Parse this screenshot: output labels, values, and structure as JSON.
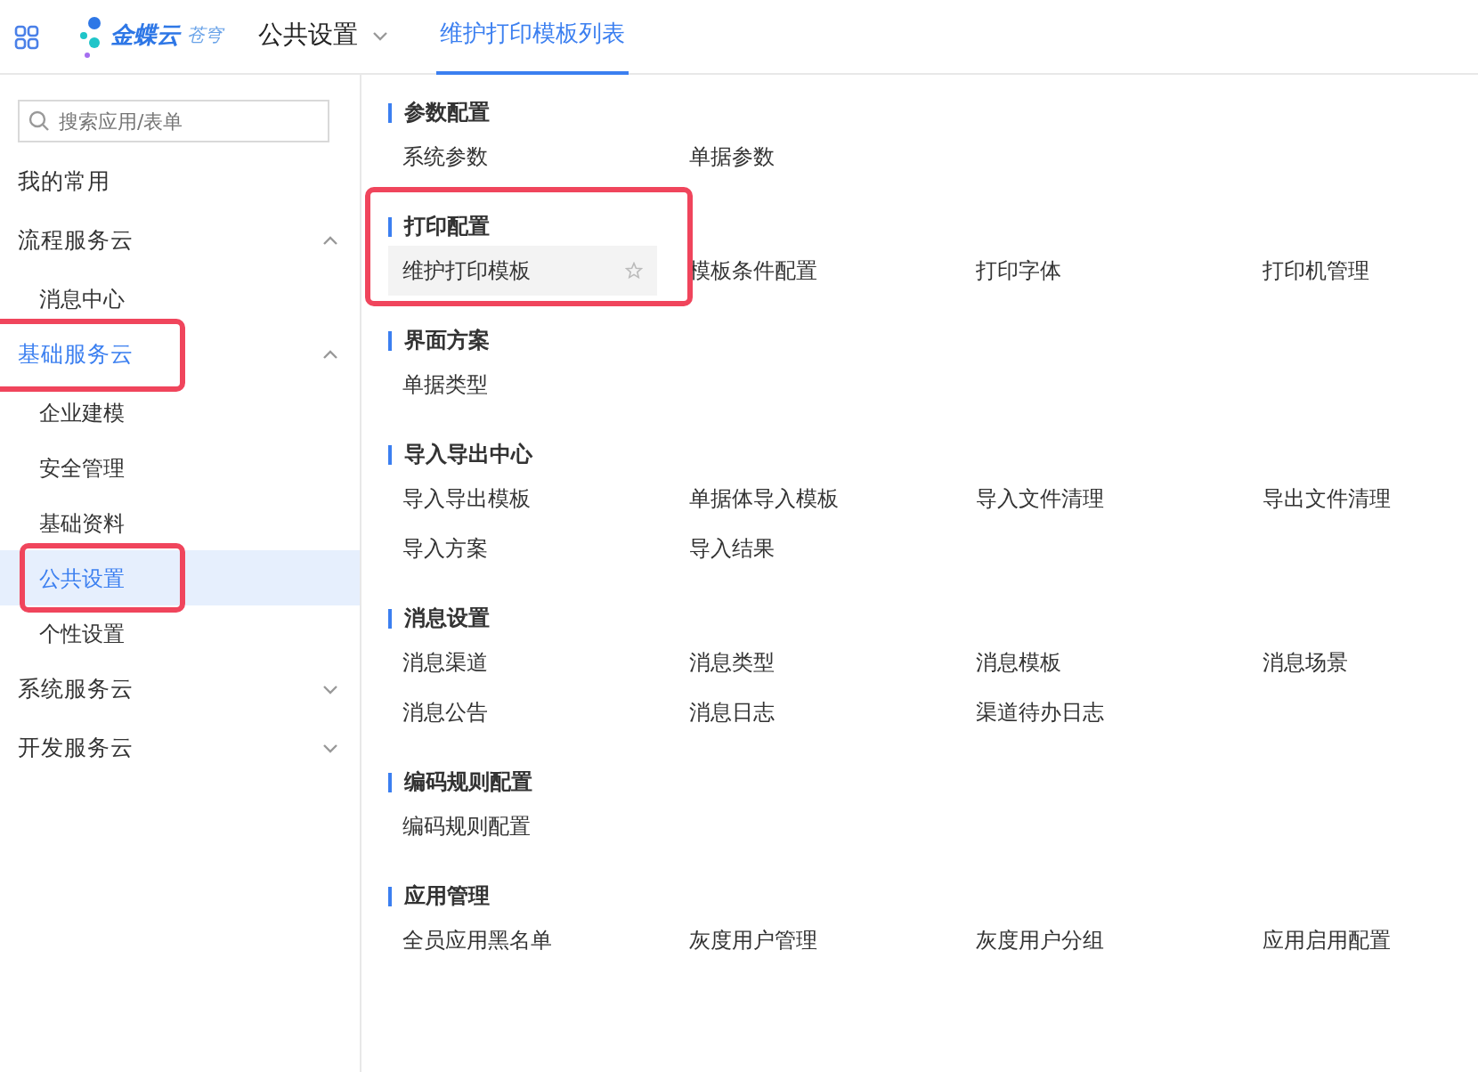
{
  "topbar": {
    "brand": "金蝶云",
    "brand_sub": "苍穹",
    "menu": "公共设置",
    "tabs": [
      {
        "label": "维护打印模板列表",
        "selected": true
      }
    ]
  },
  "sidebar": {
    "search": {
      "placeholder": "搜索应用/表单"
    },
    "items": [
      {
        "label": "我的常用",
        "selected": false
      },
      {
        "label": "流程服务云",
        "expanded": true,
        "selected": false,
        "children": [
          {
            "label": "消息中心",
            "selected": false
          }
        ]
      },
      {
        "label": "基础服务云",
        "expanded": true,
        "selected": true,
        "highlighted": true,
        "children": [
          {
            "label": "企业建模",
            "selected": false
          },
          {
            "label": "安全管理",
            "selected": false
          },
          {
            "label": "基础资料",
            "selected": false
          },
          {
            "label": "公共设置",
            "selected": true,
            "highlighted": true
          },
          {
            "label": "个性设置",
            "selected": false
          }
        ]
      },
      {
        "label": "系统服务云",
        "expanded": false,
        "selected": false
      },
      {
        "label": "开发服务云",
        "expanded": false,
        "selected": false
      }
    ]
  },
  "sections": [
    {
      "title": "参数配置",
      "items": [
        {
          "label": "系统参数",
          "hovered": false
        },
        {
          "label": "单据参数",
          "hovered": false
        }
      ]
    },
    {
      "title": "打印配置",
      "highlighted": true,
      "items": [
        {
          "label": "维护打印模板",
          "hovered": true
        },
        {
          "label": "模板条件配置",
          "hovered": false
        },
        {
          "label": "打印字体",
          "hovered": false
        },
        {
          "label": "打印机管理",
          "hovered": false
        }
      ]
    },
    {
      "title": "界面方案",
      "items": [
        {
          "label": "单据类型",
          "hovered": false
        }
      ]
    },
    {
      "title": "导入导出中心",
      "items": [
        {
          "label": "导入导出模板",
          "hovered": false
        },
        {
          "label": "单据体导入模板",
          "hovered": false
        },
        {
          "label": "导入文件清理",
          "hovered": false
        },
        {
          "label": "导出文件清理",
          "hovered": false
        },
        {
          "label": "导入方案",
          "hovered": false
        },
        {
          "label": "导入结果",
          "hovered": false
        }
      ]
    },
    {
      "title": "消息设置",
      "items": [
        {
          "label": "消息渠道",
          "hovered": false
        },
        {
          "label": "消息类型",
          "hovered": false
        },
        {
          "label": "消息模板",
          "hovered": false
        },
        {
          "label": "消息场景",
          "hovered": false
        },
        {
          "label": "消息公告",
          "hovered": false
        },
        {
          "label": "消息日志",
          "hovered": false
        },
        {
          "label": "渠道待办日志",
          "hovered": false
        }
      ]
    },
    {
      "title": "编码规则配置",
      "items": [
        {
          "label": "编码规则配置",
          "hovered": false
        }
      ]
    },
    {
      "title": "应用管理",
      "items": [
        {
          "label": "全员应用黑名单",
          "hovered": false
        },
        {
          "label": "灰度用户管理",
          "hovered": false
        },
        {
          "label": "灰度用户分组",
          "hovered": false
        },
        {
          "label": "应用启用配置",
          "hovered": false
        }
      ]
    }
  ]
}
